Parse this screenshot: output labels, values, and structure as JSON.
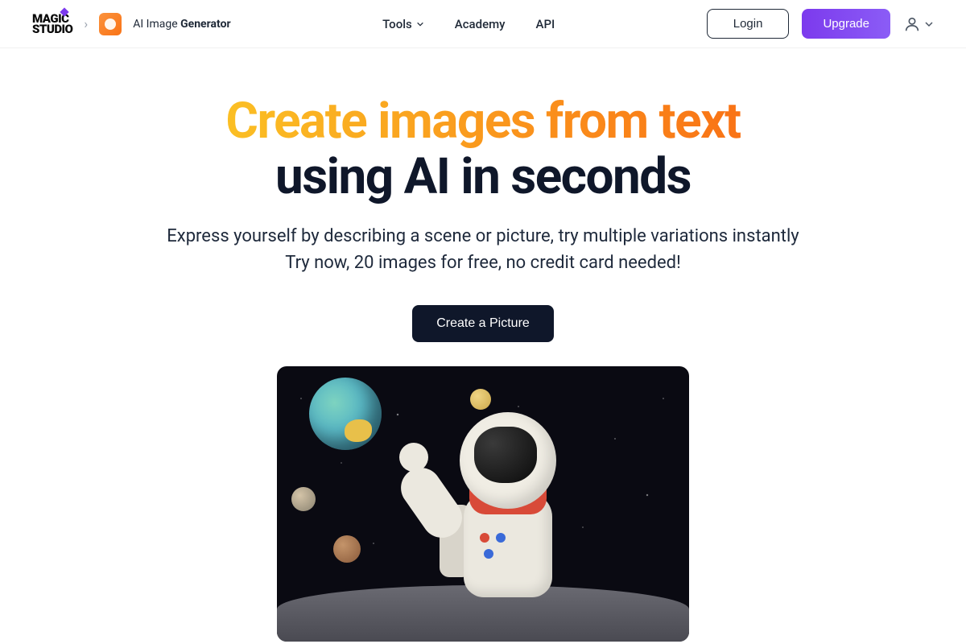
{
  "header": {
    "logo_line1": "MAGIC",
    "logo_line2": "STUDIO",
    "app_title_thin": "AI Image ",
    "app_title_bold": "Generator",
    "nav": {
      "tools": "Tools",
      "academy": "Academy",
      "api": "API"
    },
    "login": "Login",
    "upgrade": "Upgrade"
  },
  "hero": {
    "headline_gradient": "Create images from text",
    "headline_dark": "using AI in seconds",
    "subtitle_line1": "Express yourself by describing a scene or picture, try multiple variations instantly",
    "subtitle_line2": "Try now, 20 images for free, no credit card needed!",
    "cta": "Create a Picture"
  },
  "colors": {
    "accent_purple": "#7c3aed",
    "accent_orange_start": "#fbbf24",
    "accent_orange_end": "#f97316",
    "dark": "#0f172a"
  }
}
